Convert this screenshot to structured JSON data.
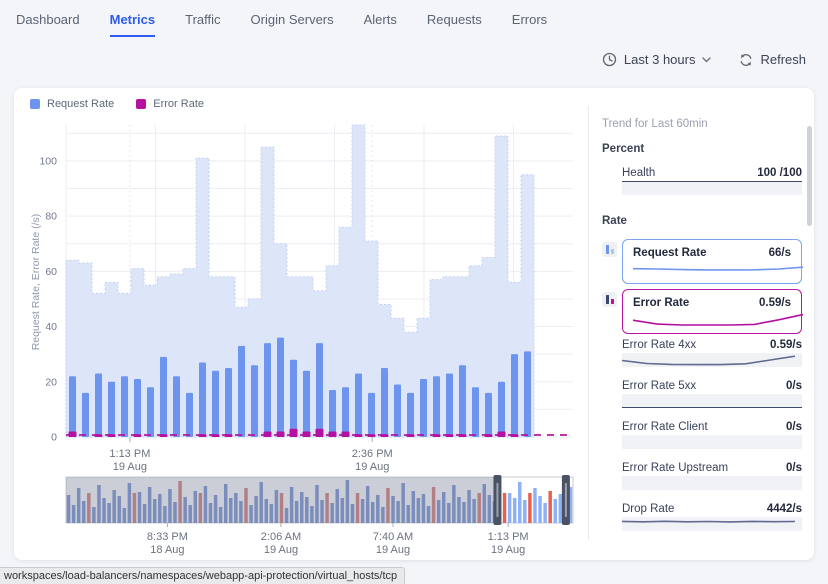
{
  "nav": {
    "items": [
      {
        "label": "Dashboard",
        "active": false
      },
      {
        "label": "Metrics",
        "active": true
      },
      {
        "label": "Traffic",
        "active": false
      },
      {
        "label": "Origin Servers",
        "active": false
      },
      {
        "label": "Alerts",
        "active": false
      },
      {
        "label": "Requests",
        "active": false
      },
      {
        "label": "Errors",
        "active": false
      }
    ]
  },
  "controls": {
    "time_range": "Last 3 hours",
    "refresh_label": "Refresh"
  },
  "legend": [
    {
      "label": "Request Rate",
      "color": "#6e95ee"
    },
    {
      "label": "Error Rate",
      "color": "#b511a0"
    }
  ],
  "colors": {
    "bar_blue": "#6e95ee",
    "area_fill": "#dde6f9",
    "area_outline": "#c2d1f3",
    "error_magenta": "#b511a0",
    "grid": "#eceef3",
    "mini_bar": "#4f6fc4",
    "mini_bar_selected": "#8db1f4",
    "mini_red": "#c5534a",
    "mini_red_selected": "#e8614e",
    "overlay_gray": "rgba(160,166,180,0.55)",
    "handle": "#4a5264",
    "accent_blue": "#2e5bf0"
  },
  "chart_data": [
    {
      "type": "bar",
      "name": "main-chart",
      "title": "",
      "ylabel": "Request Rate, Error Rate (/s)",
      "ylim": [
        0,
        113
      ],
      "yticks": [
        0,
        20,
        40,
        60,
        80,
        100
      ],
      "grid": true,
      "x_ticks": [
        {
          "time": "1:13 PM",
          "date": "19 Aug",
          "pos": 0.126
        },
        {
          "time": "2:36 PM",
          "date": "19 Aug",
          "pos": 0.604
        }
      ],
      "series": [
        {
          "name": "Request Rate (area)",
          "type": "step-area",
          "values": [
            64,
            63,
            52,
            56,
            52,
            61,
            55,
            58,
            59,
            61,
            101,
            58,
            58,
            47,
            50,
            105,
            70,
            58,
            58,
            53,
            62,
            76,
            113,
            71,
            48,
            43,
            38,
            43,
            57,
            58,
            58,
            62,
            65,
            109,
            56,
            95,
            0,
            0,
            0
          ]
        },
        {
          "name": "Request Rate",
          "type": "bar",
          "values": [
            22,
            16,
            23,
            20,
            22,
            21,
            18,
            29,
            22,
            16,
            27,
            24,
            25,
            33,
            26,
            34,
            36,
            28,
            24,
            34,
            17,
            18,
            23,
            16,
            25,
            19,
            16,
            21,
            22,
            23,
            26,
            18,
            16,
            20,
            30,
            31,
            0,
            0,
            0
          ]
        },
        {
          "name": "Error Rate",
          "type": "bar",
          "values": [
            2,
            0,
            1,
            1,
            0,
            1,
            0,
            1,
            0,
            0,
            1,
            1,
            1,
            0,
            0,
            2,
            2,
            3,
            2,
            3,
            2,
            2,
            1,
            1,
            1,
            0,
            1,
            0,
            1,
            1,
            1,
            0,
            1,
            2,
            1,
            0,
            0,
            0,
            0
          ]
        }
      ]
    },
    {
      "type": "bar",
      "name": "overview-brush-chart",
      "values": [
        28,
        18,
        35,
        22,
        30,
        16,
        38,
        25,
        20,
        33,
        27,
        15,
        40,
        23,
        31,
        19,
        36,
        24,
        29,
        17,
        34,
        21,
        42,
        26,
        18,
        32,
        23,
        37,
        20,
        28,
        16,
        39,
        25,
        30,
        22,
        35,
        18,
        27,
        41,
        24,
        19,
        33,
        28,
        15,
        36,
        22,
        31,
        26,
        17,
        38,
        23,
        29,
        20,
        34,
        25,
        43,
        19,
        30,
        24,
        37,
        21,
        28,
        16,
        35,
        27,
        22,
        40,
        18,
        32,
        25,
        29,
        17,
        36,
        23,
        31,
        20,
        38,
        26,
        21,
        33,
        24,
        18,
        39,
        28,
        22,
        34,
        19,
        30,
        25,
        41,
        23,
        17,
        35,
        27,
        20,
        32,
        24,
        29,
        18,
        36
      ],
      "red_indices": [
        4,
        13,
        22,
        26,
        35,
        42,
        51,
        57,
        63,
        72,
        81,
        86,
        91,
        95
      ],
      "selection": [
        0.85,
        0.985
      ],
      "x_ticks": [
        {
          "time": "8:33 PM",
          "date": "18 Aug",
          "pos": 0.2
        },
        {
          "time": "2:06 AM",
          "date": "19 Aug",
          "pos": 0.424
        },
        {
          "time": "7:40 AM",
          "date": "19 Aug",
          "pos": 0.645
        },
        {
          "time": "1:13 PM",
          "date": "19 Aug",
          "pos": 0.872
        }
      ]
    }
  ],
  "sidebar": {
    "title": "Trend for Last 60min",
    "percent_heading": "Percent",
    "rate_heading": "Rate",
    "rows": [
      {
        "section": "percent",
        "label": "Health",
        "value": "100 /100",
        "trend": "flat-top"
      },
      {
        "section": "rate",
        "label": "Request Rate",
        "value": "66/s",
        "box": "#7aa3f2",
        "icon": "bar-chart-icon",
        "spark": [
          0.52,
          0.5,
          0.46,
          0.44,
          0.44,
          0.45,
          0.5,
          0.62
        ],
        "spark_color": "#6e95ee"
      },
      {
        "section": "rate",
        "label": "Error Rate",
        "value": "0.59/s",
        "box": "#bb16a3",
        "icon": "bar-chart-icon",
        "spark": [
          0.42,
          0.16,
          0.1,
          0.1,
          0.1,
          0.14,
          0.45,
          0.8
        ],
        "spark_color": "#b30f9e"
      },
      {
        "section": "rate",
        "label": "Error Rate 4xx",
        "value": "0.59/s",
        "spark": [
          0.45,
          0.18,
          0.1,
          0.08,
          0.08,
          0.15,
          0.5,
          0.85
        ],
        "spark_color": "#5f6b90"
      },
      {
        "section": "rate",
        "label": "Error Rate 5xx",
        "value": "0/s",
        "trend": "flat-bottom"
      },
      {
        "section": "rate",
        "label": "Error Rate Client",
        "value": "0/s",
        "trend": "none"
      },
      {
        "section": "rate",
        "label": "Error Rate Upstream",
        "value": "0/s",
        "trend": "none"
      },
      {
        "section": "rate",
        "label": "Drop Rate",
        "value": "4442/s",
        "spark": [
          0.74,
          0.7,
          0.75,
          0.7,
          0.73,
          0.69,
          0.74,
          0.71,
          0.73
        ],
        "spark_color": "#5f6b90"
      }
    ]
  },
  "statusbar": {
    "text": "workspaces/load-balancers/namespaces/webapp-api-protection/virtual_hosts/tcp"
  }
}
